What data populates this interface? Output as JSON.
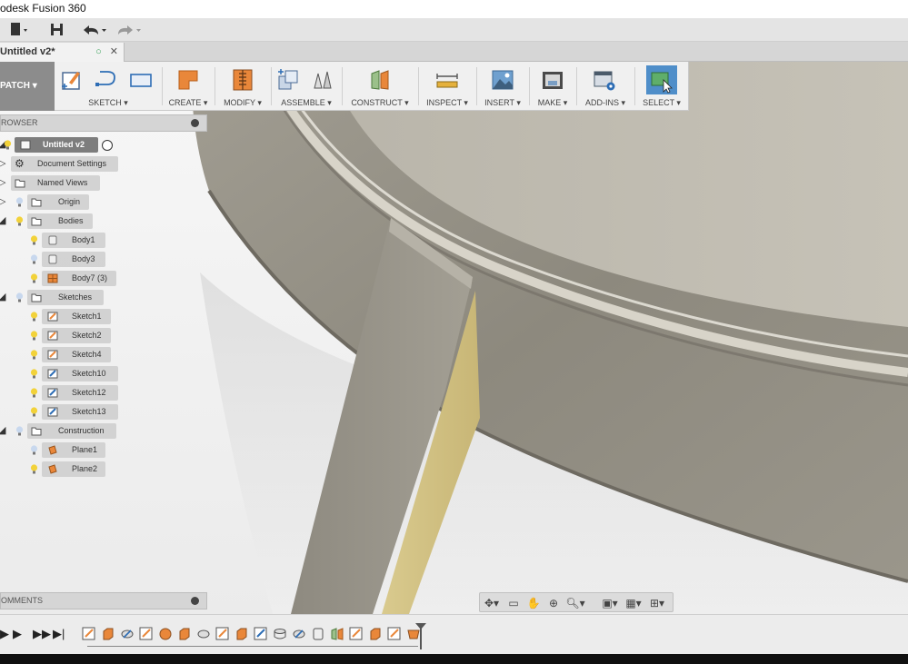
{
  "window": {
    "title": "odesk Fusion 360"
  },
  "document_tab": {
    "label": "Untitled v2*",
    "close_glyph": "✕",
    "status_glyph": "○"
  },
  "workspace": {
    "label": "PATCH ▾"
  },
  "toolbar": {
    "groups": [
      {
        "label": "SKETCH ▾"
      },
      {
        "label": "CREATE ▾"
      },
      {
        "label": "MODIFY ▾"
      },
      {
        "label": "ASSEMBLE ▾"
      },
      {
        "label": "CONSTRUCT ▾"
      },
      {
        "label": "INSPECT ▾"
      },
      {
        "label": "INSERT ▾"
      },
      {
        "label": "MAKE ▾"
      },
      {
        "label": "ADD-INS ▾"
      },
      {
        "label": "SELECT ▾"
      }
    ]
  },
  "browser": {
    "header": "ROWSER",
    "root": "Untitled v2",
    "items": [
      {
        "label": "Document Settings"
      },
      {
        "label": "Named Views"
      },
      {
        "label": "Origin"
      },
      {
        "label": "Bodies"
      },
      {
        "label": "Body1"
      },
      {
        "label": "Body3"
      },
      {
        "label": "Body7 (3)"
      },
      {
        "label": "Sketches"
      },
      {
        "label": "Sketch1"
      },
      {
        "label": "Sketch2"
      },
      {
        "label": "Sketch4"
      },
      {
        "label": "Sketch10"
      },
      {
        "label": "Sketch12"
      },
      {
        "label": "Sketch13"
      },
      {
        "label": "Construction"
      },
      {
        "label": "Plane1"
      },
      {
        "label": "Plane2"
      }
    ]
  },
  "comments": {
    "label": "OMMENTS"
  },
  "colors": {
    "model_gray": "#8b877b",
    "leg_gold": "#d8c98c",
    "select_blue": "#4f8ec9",
    "create_orange": "#e9873a"
  }
}
